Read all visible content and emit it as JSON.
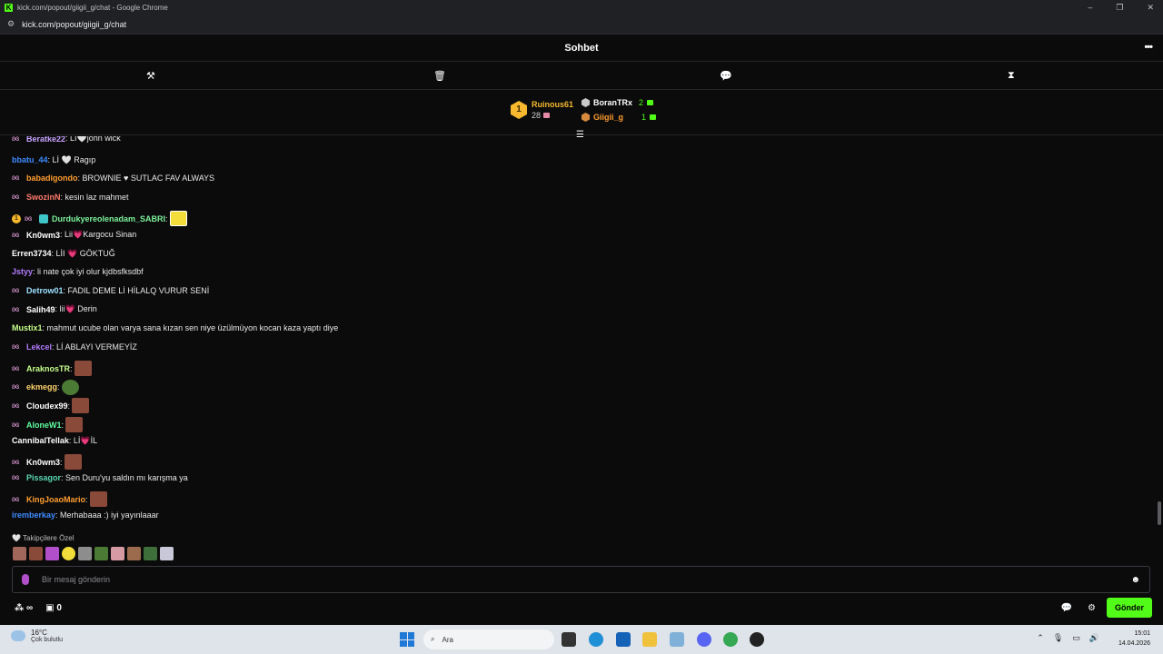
{
  "browser": {
    "title": "kick.com/popout/giigii_g/chat - Google Chrome",
    "url": "kick.com/popout/giigii_g/chat"
  },
  "chat": {
    "title": "Sohbet",
    "leaderboard": {
      "first": {
        "rank": "1",
        "name": "Ruinous61",
        "count": "28"
      },
      "second": {
        "name": "BoranTRx",
        "count": "2"
      },
      "third": {
        "name": "Giigii_g",
        "count": "1"
      }
    },
    "messages": [
      {
        "user": "Beratke22",
        "color": "#c9a4ff",
        "badges": [
          "butterfly"
        ],
        "text": ": Lİ🤍john wick"
      },
      {
        "user": "bbatu_44",
        "color": "#3d8bff",
        "badges": [],
        "text": ": Lİ 🤍 Ragıp"
      },
      {
        "user": "babadigondo",
        "color": "#ff9d2f",
        "badges": [
          "butterfly"
        ],
        "text": ": BROWNIE ♥ SUTLAC FAV ALWAYS"
      },
      {
        "user": "SwozinN",
        "color": "#ff7a6b",
        "badges": [
          "butterfly"
        ],
        "text": ": kesin laz mahmet"
      },
      {
        "user": "Durdukyereolenadam_SABRI",
        "color": "#7cf29a",
        "badges": [
          "gold",
          "butterfly",
          "sub"
        ],
        "text": ":",
        "emote": "yellow"
      },
      {
        "user": "Kn0wm3",
        "color": "#ffffff",
        "badges": [
          "butterfly"
        ],
        "text": ": Lii💗Kargocu Sinan"
      },
      {
        "user": "Erren3734",
        "color": "#ffffff",
        "badges": [],
        "text": ": LİI 💗 GÖKTUĞ"
      },
      {
        "user": "Jstyy",
        "color": "#b57bff",
        "badges": [],
        "text": ": li nate çok iyi olur kjdbsfksdbf"
      },
      {
        "user": "Detrow01",
        "color": "#9de0ff",
        "badges": [
          "butterfly"
        ],
        "text": ": FADIL DEME Lİ HİLALQ VURUR SENİ"
      },
      {
        "user": "Salih49",
        "color": "#ffffff",
        "badges": [
          "butterfly"
        ],
        "text": ": lii💗 Derin"
      },
      {
        "user": "Mustix1",
        "color": "#c6ff8a",
        "badges": [],
        "text": ": mahmut ucube olan varya sana kızan sen niye üzülmüyon kocan kaza yaptı diye"
      },
      {
        "user": "Lekcel",
        "color": "#b57bff",
        "badges": [
          "butterfly"
        ],
        "text": ": Lİ ABLAYI VERMEYİZ"
      },
      {
        "user": "AraknosTR",
        "color": "#c6ff8a",
        "badges": [
          "butterfly"
        ],
        "text": ":",
        "emote": "brown"
      },
      {
        "user": "ekmegg",
        "color": "#ffd36b",
        "badges": [
          "butterfly"
        ],
        "text": ":",
        "emote": "green"
      },
      {
        "user": "Cloudex99",
        "color": "#ffffff",
        "badges": [
          "butterfly"
        ],
        "text": ":",
        "emote": "brown"
      },
      {
        "user": "AloneW1",
        "color": "#5dff9f",
        "badges": [
          "butterfly"
        ],
        "text": ":",
        "emote": "brown"
      },
      {
        "user": "CannibalTellak",
        "color": "#ffffff",
        "badges": [],
        "text": ": Lİ💗İL"
      },
      {
        "user": "Kn0wm3",
        "color": "#ffffff",
        "badges": [
          "butterfly"
        ],
        "text": ":",
        "emote": "brown"
      },
      {
        "user": "Pissagor",
        "color": "#5ad6b0",
        "badges": [
          "butterfly"
        ],
        "text": ": Sen Duru'yu saldın mı karışma ya"
      },
      {
        "user": "KingJoaoMario",
        "color": "#ff9d2f",
        "badges": [
          "butterfly"
        ],
        "text": ":",
        "emote": "brown"
      },
      {
        "user": "iremberkay",
        "color": "#3d8bff",
        "badges": [],
        "text": ": Merhabaaa :) iyi yayınlaaar"
      }
    ],
    "followers_only_label": "Takipçilere Özel",
    "input_placeholder": "Bir mesaj gönderin",
    "points_value": "∞",
    "gift_count": "0",
    "send_label": "Gönder"
  },
  "taskbar": {
    "weather_temp": "16°C",
    "weather_desc": "Çok bulutlu",
    "search_placeholder": "Ara",
    "time": "15:01",
    "date": "14.04.2026"
  }
}
